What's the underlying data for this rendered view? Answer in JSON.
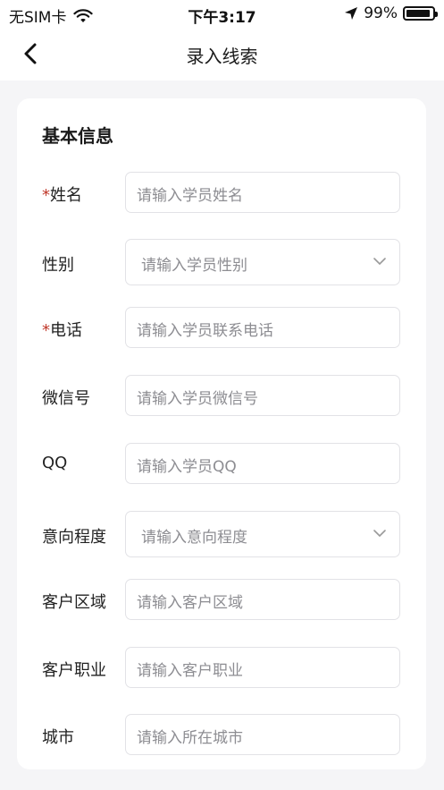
{
  "status_bar": {
    "carrier": "无SIM卡",
    "time": "下午3:17",
    "battery": "99%"
  },
  "nav": {
    "title": "录入线索"
  },
  "form": {
    "section_title": "基本信息",
    "fields": [
      {
        "label": "姓名",
        "required": "*",
        "placeholder": "请输入学员姓名"
      },
      {
        "label": "性别",
        "placeholder": "请输入学员性别"
      },
      {
        "label": "电话",
        "required": "*",
        "placeholder": "请输入学员联系电话"
      },
      {
        "label": "微信号",
        "placeholder": "请输入学员微信号"
      },
      {
        "label": "QQ",
        "placeholder": "请输入学员QQ"
      },
      {
        "label": "意向程度",
        "placeholder": "请输入意向程度"
      },
      {
        "label": "客户区域",
        "placeholder": "请输入客户区域"
      },
      {
        "label": "客户职业",
        "placeholder": "请输入客户职业"
      },
      {
        "label": "城市",
        "placeholder": "请输入所在城市"
      }
    ]
  }
}
